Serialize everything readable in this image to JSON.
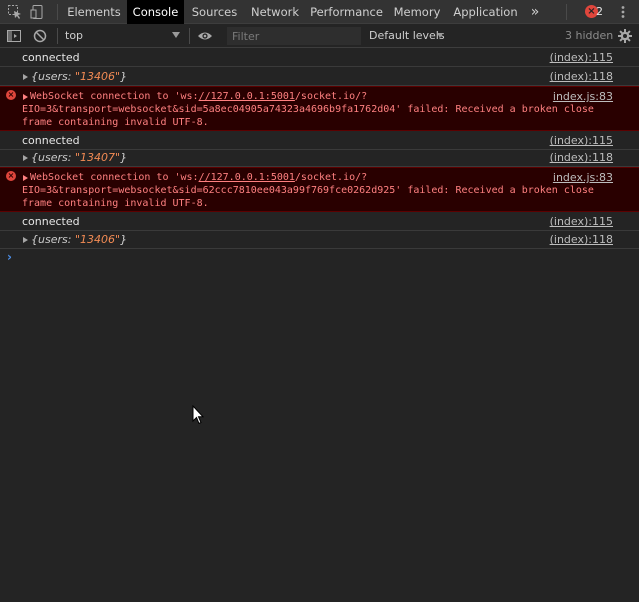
{
  "tabs": [
    {
      "label": "Elements"
    },
    {
      "label": "Console",
      "active": true
    },
    {
      "label": "Sources"
    },
    {
      "label": "Network"
    },
    {
      "label": "Performance"
    },
    {
      "label": "Memory"
    },
    {
      "label": "Application"
    }
  ],
  "more_tabs_label": "»",
  "error_count": "2",
  "toolbar": {
    "context": "top",
    "filter_placeholder": "Filter",
    "levels": "Default levels",
    "hidden": "3 hidden"
  },
  "messages": [
    {
      "text": "connected",
      "source": "(index):115"
    },
    {
      "key": "users",
      "value": "\"13406\"",
      "source": "(index):118"
    },
    {
      "error_prefix": "WebSocket connection to 'ws:",
      "error_link": "//127.0.0.1:5001",
      "error_rest": "/socket.io/?\nEIO=3&transport=websocket&sid=5a8ec04905a74323a4696b9fa1762d04' failed: Received a broken close\nframe containing invalid UTF-8.",
      "source": "index.js:83"
    },
    {
      "text": "connected",
      "source": "(index):115"
    },
    {
      "key": "users",
      "value": "\"13407\"",
      "source": "(index):118"
    },
    {
      "error_prefix": "WebSocket connection to 'ws:",
      "error_link": "//127.0.0.1:5001",
      "error_rest": "/socket.io/?\nEIO=3&transport=websocket&sid=62ccc7810ee043a99f769fce0262d925' failed: Received a broken close\nframe containing invalid UTF-8.",
      "source": "index.js:83"
    },
    {
      "text": "connected",
      "source": "(index):115"
    },
    {
      "key": "users",
      "value": "\"13406\"",
      "source": "(index):118"
    }
  ],
  "prompt_symbol": "›",
  "colors": {
    "error_text": "#ff8080",
    "error_bg": "#290000",
    "string_value": "#f28b54",
    "prompt": "#4c8fe8"
  }
}
